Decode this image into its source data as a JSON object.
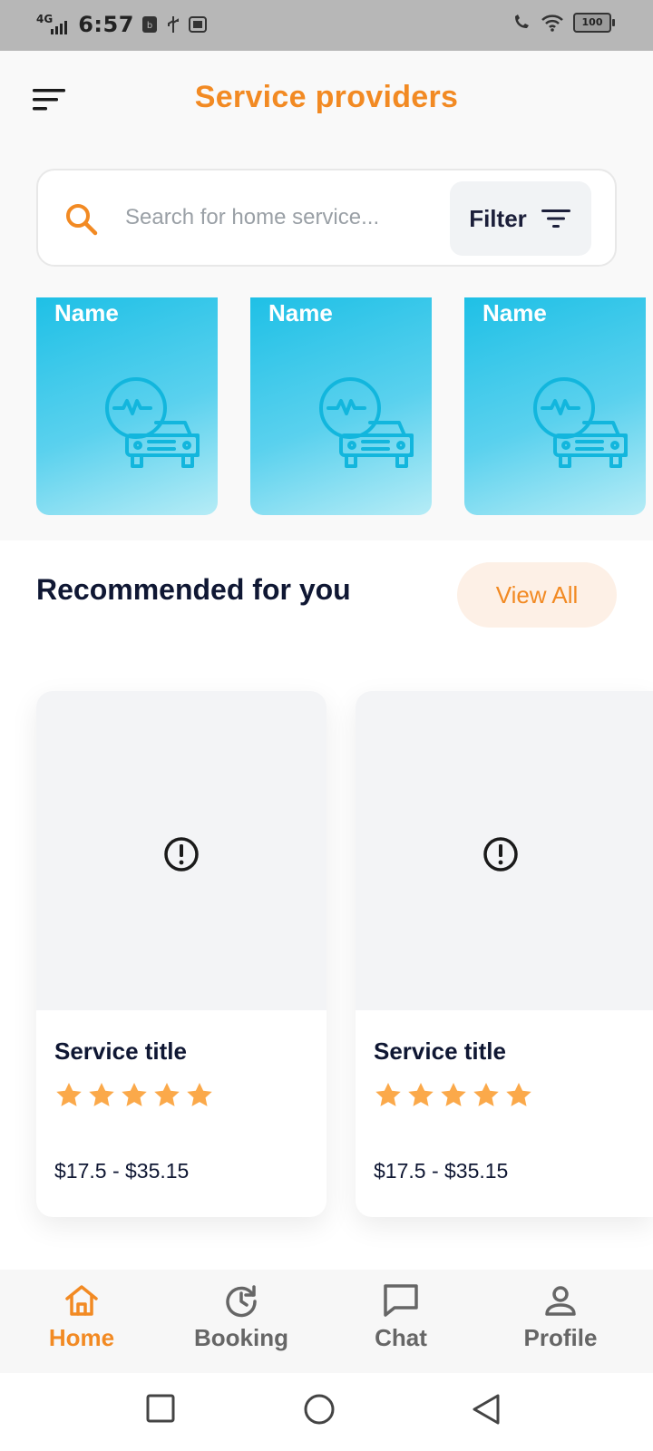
{
  "status_bar": {
    "network": "4G",
    "time": "6:57",
    "battery": "100"
  },
  "header": {
    "title": "Service providers",
    "menu_icon": "menu-sort-icon"
  },
  "search": {
    "placeholder": "Search for home service...",
    "value": "",
    "filter_label": "Filter"
  },
  "providers": [
    {
      "name": "Name",
      "icon": "car-diagnostics-icon"
    },
    {
      "name": "Name",
      "icon": "car-diagnostics-icon"
    },
    {
      "name": "Name",
      "icon": "car-diagnostics-icon"
    }
  ],
  "recommended": {
    "title": "Recommended for you",
    "view_all": "View All",
    "items": [
      {
        "title": "Service title",
        "rating": 5,
        "price": "$17.5 - $35.15",
        "image_icon": "image-error-icon"
      },
      {
        "title": "Service title",
        "rating": 5,
        "price": "$17.5 - $35.15",
        "image_icon": "image-error-icon"
      }
    ]
  },
  "bottom_nav": {
    "items": [
      {
        "label": "Home",
        "icon": "home-icon",
        "active": true
      },
      {
        "label": "Booking",
        "icon": "history-icon",
        "active": false
      },
      {
        "label": "Chat",
        "icon": "chat-icon",
        "active": false
      },
      {
        "label": "Profile",
        "icon": "person-icon",
        "active": false
      }
    ]
  },
  "colors": {
    "accent": "#f28a23",
    "dark_text": "#0f1733",
    "card_gradient_start": "#1fc0e6",
    "star": "#fba94a"
  }
}
